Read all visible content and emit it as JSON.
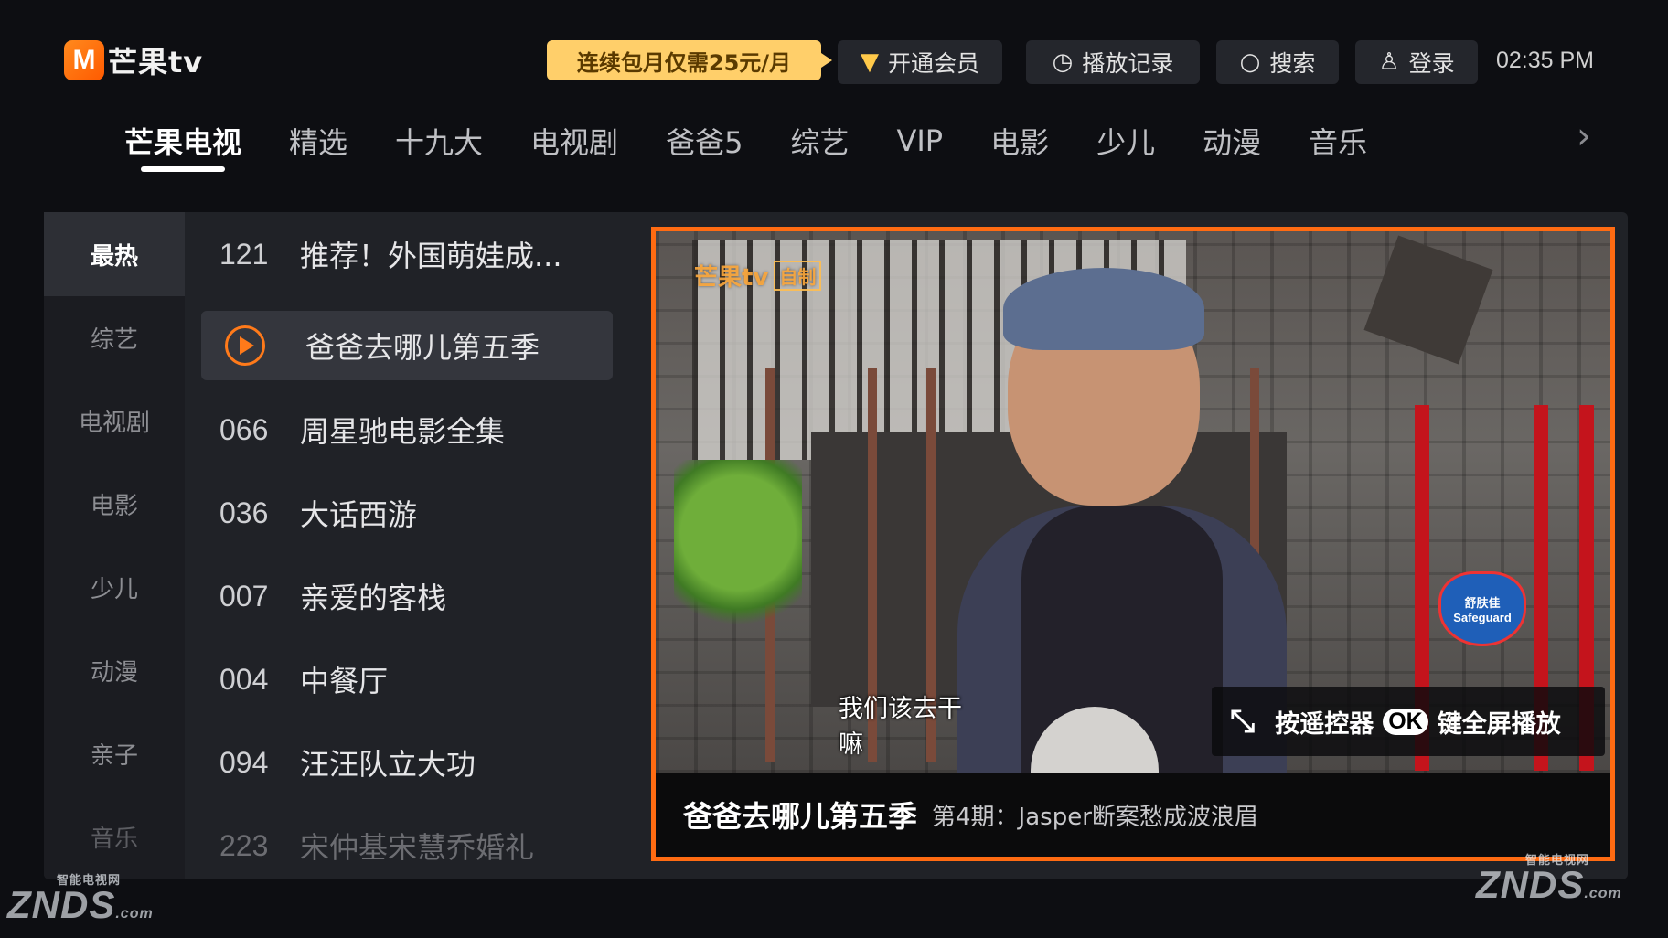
{
  "header": {
    "logo_mark": "M",
    "logo_text": "芒果tv",
    "promo": "连续包月仅需25元/月",
    "buttons": [
      {
        "label": "开通会员",
        "icon": "diamond-icon"
      },
      {
        "label": "播放记录",
        "icon": "clock-icon"
      },
      {
        "label": "搜索",
        "icon": "search-icon"
      },
      {
        "label": "登录",
        "icon": "user-icon"
      }
    ],
    "time": "02:35 PM"
  },
  "nav": {
    "tabs": [
      "芒果电视",
      "精选",
      "十九大",
      "电视剧",
      "爸爸5",
      "综艺",
      "VIP",
      "电影",
      "少儿",
      "动漫",
      "音乐"
    ],
    "active_index": 0
  },
  "sidebar": {
    "items": [
      "最热",
      "综艺",
      "电视剧",
      "电影",
      "少儿",
      "动漫",
      "亲子",
      "音乐"
    ],
    "active_index": 0
  },
  "list": {
    "items": [
      {
        "num": "121",
        "title": "推荐！外国萌娃成..."
      },
      {
        "num": "",
        "title": "爸爸去哪儿第五季",
        "playing": true
      },
      {
        "num": "066",
        "title": "周星驰电影全集"
      },
      {
        "num": "036",
        "title": "大话西游"
      },
      {
        "num": "007",
        "title": "亲爱的客栈"
      },
      {
        "num": "004",
        "title": "中餐厅"
      },
      {
        "num": "094",
        "title": "汪汪队立大功"
      },
      {
        "num": "223",
        "title": "宋仲基宋慧乔婚礼"
      }
    ]
  },
  "player": {
    "watermark_logo": "芒果tv",
    "watermark_tag": "自制",
    "sponsor_cn": "舒肤佳",
    "sponsor_en": "Safeguard",
    "subtitle": "我们该去干嘛",
    "hint_prefix": "按遥控器",
    "hint_key": "OK",
    "hint_suffix": "键全屏播放",
    "show_title": "爸爸去哪儿第五季",
    "episode": "第4期：Jasper断案愁成波浪眉"
  },
  "site_watermark": {
    "brand": "ZNDS",
    "suffix": ".com",
    "cn": "智能电视网"
  },
  "colors": {
    "accent": "#ff6b12",
    "promo_bg": "#ffcf6a",
    "background": "#0d0e12"
  }
}
